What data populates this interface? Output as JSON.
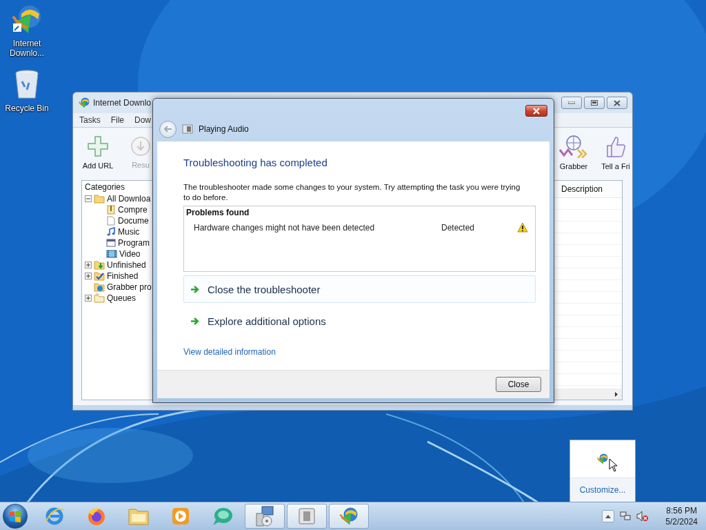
{
  "desktop_icons": [
    {
      "label": "Internet Downlo...",
      "kind": "idm"
    },
    {
      "label": "Recycle Bin",
      "kind": "recycle"
    }
  ],
  "idm_window": {
    "title": "Internet Downlo",
    "menu": [
      "Tasks",
      "File",
      "Dow"
    ],
    "toolbar_left": [
      {
        "label": "Add URL",
        "disabled": false,
        "kind": "add"
      },
      {
        "label": "Resu",
        "disabled": true,
        "kind": "resume"
      }
    ],
    "toolbar_right": [
      {
        "label": "Grabber",
        "kind": "grabber"
      },
      {
        "label": "Tell a Fri",
        "kind": "tell"
      }
    ],
    "tree": {
      "title": "Categories",
      "items": [
        {
          "label": "All Downloa",
          "kind": "folder",
          "expanded": true,
          "children": [
            {
              "label": "Compre",
              "kind": "archive"
            },
            {
              "label": "Docume",
              "kind": "document"
            },
            {
              "label": "Music",
              "kind": "music"
            },
            {
              "label": "Program",
              "kind": "program"
            },
            {
              "label": "Video",
              "kind": "video"
            }
          ]
        },
        {
          "label": "Unfinished",
          "kind": "unfinished",
          "expanded": false
        },
        {
          "label": "Finished",
          "kind": "finished",
          "expanded": false
        },
        {
          "label": "Grabber pro",
          "kind": "grabber"
        },
        {
          "label": "Queues",
          "kind": "queues",
          "expanded": false
        }
      ]
    },
    "list": {
      "columns": [
        "Description"
      ]
    }
  },
  "dialog": {
    "title": "Playing Audio",
    "heading": "Troubleshooting has completed",
    "message": "The troubleshooter made some changes to your system. Try attempting the task you were trying to do before.",
    "problems": {
      "title": "Problems found",
      "rows": [
        {
          "problem": "Hardware changes might not have been detected",
          "status": "Detected"
        }
      ]
    },
    "options": [
      {
        "label": "Close the troubleshooter",
        "selected": true
      },
      {
        "label": "Explore additional options",
        "selected": false
      }
    ],
    "details_link": "View detailed information",
    "buttons": [
      "Close"
    ]
  },
  "tray_popup": {
    "link": "Customize..."
  },
  "taskbar": {
    "apps": [
      {
        "kind": "ie",
        "running": false
      },
      {
        "kind": "firefox",
        "running": false
      },
      {
        "kind": "explorer",
        "running": false
      },
      {
        "kind": "media",
        "running": false
      },
      {
        "kind": "chat",
        "running": false
      },
      {
        "kind": "installer",
        "running": true
      },
      {
        "kind": "viewer",
        "running": true
      },
      {
        "kind": "idm",
        "running": true
      }
    ],
    "clock": {
      "time": "8:56 PM",
      "date": "5/2/2024"
    }
  }
}
